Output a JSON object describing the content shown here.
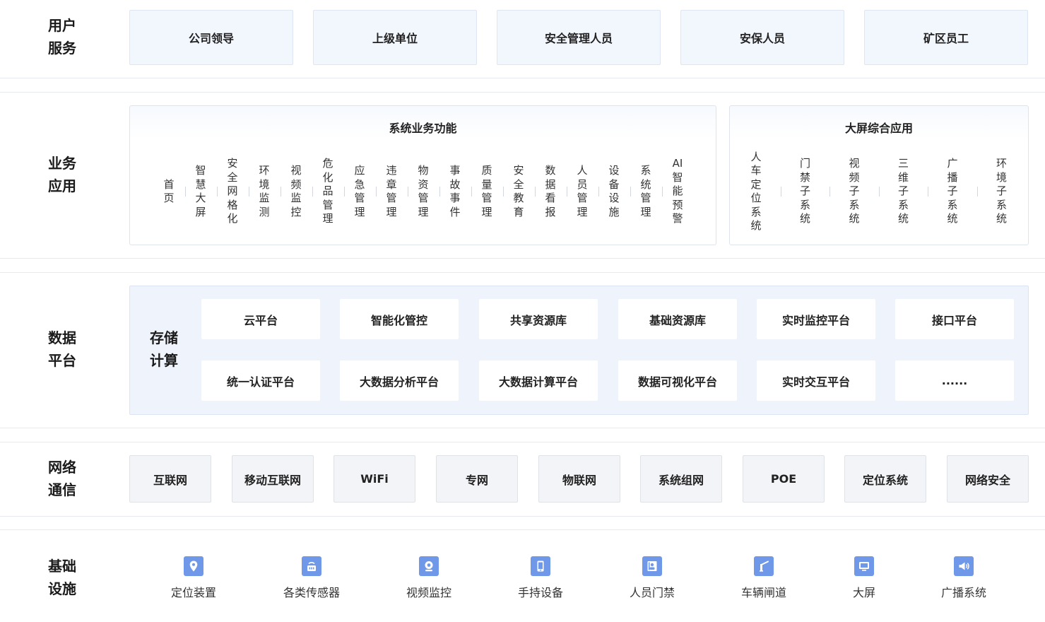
{
  "layers": {
    "user": {
      "label": "用户\n服务",
      "items": [
        "公司领导",
        "上级单位",
        "安全管理人员",
        "安保人员",
        "矿区员工"
      ]
    },
    "business": {
      "label": "业务\n应用",
      "system": {
        "title": "系统业务功能",
        "items": [
          "首页",
          "智慧大屏",
          "安全网格化",
          "环境监测",
          "视频监控",
          "危化品管理",
          "应急管理",
          "违章管理",
          "物资管理",
          "事故事件",
          "质量管理",
          "安全教育",
          "数据看报",
          "人员管理",
          "设备设施",
          "系统管理",
          "AI智能预警"
        ]
      },
      "screen": {
        "title": "大屏综合应用",
        "items": [
          "人车定位系统",
          "门禁子系统",
          "视频子系统",
          "三维子系统",
          "广播子系统",
          "环境子系统"
        ]
      }
    },
    "data": {
      "label": "数据\n平台",
      "sub_label": "存储\n计算",
      "row1": [
        "云平台",
        "智能化管控",
        "共享资源库",
        "基础资源库",
        "实时监控平台",
        "接口平台"
      ],
      "row2": [
        "统一认证平台",
        "大数据分析平台",
        "大数据计算平台",
        "数据可视化平台",
        "实时交互平台",
        "......"
      ]
    },
    "network": {
      "label": "网络\n通信",
      "items": [
        "互联网",
        "移动互联网",
        "WiFi",
        "专网",
        "物联网",
        "系统组网",
        "POE",
        "定位系统",
        "网络安全"
      ]
    },
    "infra": {
      "label": "基础\n设施",
      "items": [
        {
          "label": "定位装置",
          "icon": "location-pin-icon"
        },
        {
          "label": "各类传感器",
          "icon": "sensor-icon"
        },
        {
          "label": "视频监控",
          "icon": "camera-icon"
        },
        {
          "label": "手持设备",
          "icon": "handheld-device-icon"
        },
        {
          "label": "人员门禁",
          "icon": "access-control-icon"
        },
        {
          "label": "车辆闸道",
          "icon": "barrier-gate-icon"
        },
        {
          "label": "大屏",
          "icon": "big-screen-icon"
        },
        {
          "label": "广播系统",
          "icon": "broadcast-icon"
        }
      ]
    }
  },
  "colors": {
    "accent": "#6f98e8",
    "user_box_bg": "#f2f6fd",
    "data_panel_bg": "#eef3fc",
    "net_box_bg": "#f2f4f7",
    "border": "#e6e9ee"
  }
}
